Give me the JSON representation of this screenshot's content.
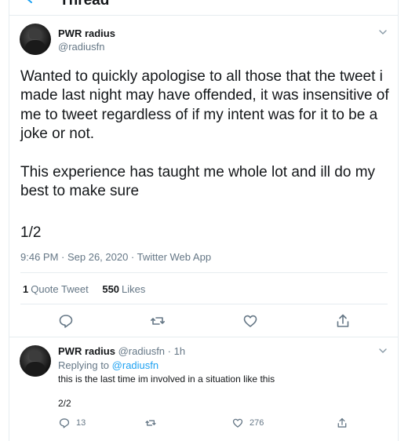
{
  "header": {
    "title": "Thread"
  },
  "tweet": {
    "name": "PWR radius",
    "handle": "@radiusfn",
    "text": "Wanted to quickly apologise to all those that the tweet i made last night may have offended, it was insensitive of me to tweet regardless of if my intent was for it to be a joke or not.\n\nThis experience has taught me whole lot and ill do my best to make sure",
    "count": "1/2",
    "meta": "9:46 PM · Sep 26, 2020 · Twitter Web App",
    "stats": {
      "quote_count": "1",
      "quote_label": "Quote Tweet",
      "like_count": "550",
      "like_label": "Likes"
    },
    "icons": [
      "reply-icon",
      "retweet-icon",
      "like-icon",
      "share-icon"
    ]
  },
  "reply": {
    "name": "PWR radius",
    "handle": "@radiusfn",
    "dot": "·",
    "time": "1h",
    "replying_prefix": "Replying to",
    "replying_to": "@radiusfn",
    "text": "this is the last time im involved in a situation like this",
    "count": "2/2",
    "reply_count": "13",
    "retweet_count": "",
    "like_count": "276"
  },
  "colors": {
    "accent": "#1da1f2",
    "muted": "#657786",
    "border": "#e6ecf0"
  }
}
